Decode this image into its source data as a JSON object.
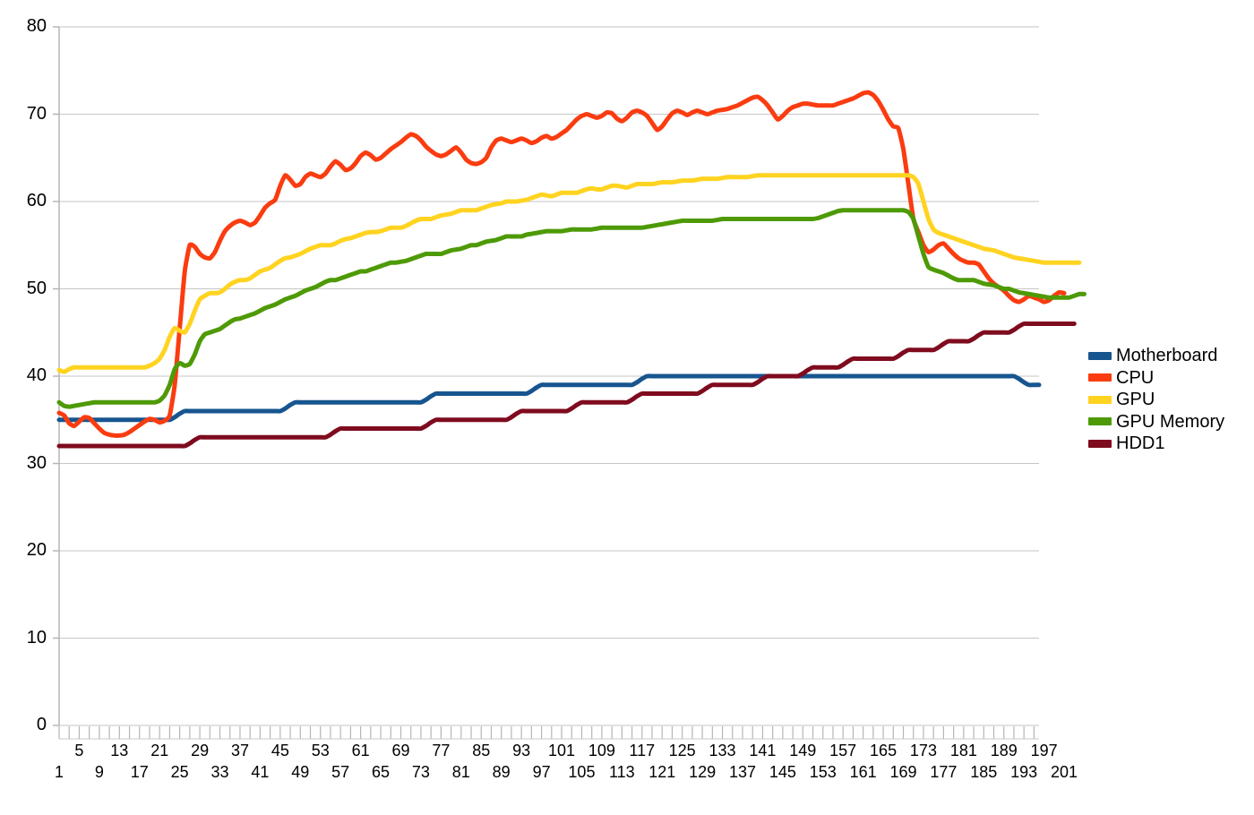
{
  "chart_data": {
    "type": "line",
    "title": "",
    "xlabel": "",
    "ylabel": "",
    "xlim": [
      1,
      201
    ],
    "ylim": [
      0,
      80
    ],
    "grid": true,
    "y_ticks": [
      0,
      10,
      20,
      30,
      40,
      50,
      60,
      70,
      80
    ],
    "x_tick_labels_upper": [
      5,
      13,
      21,
      29,
      37,
      45,
      53,
      61,
      69,
      77,
      85,
      93,
      101,
      109,
      117,
      125,
      133,
      141,
      149,
      157,
      165,
      173,
      181,
      189,
      197
    ],
    "x_tick_labels_lower": [
      1,
      9,
      17,
      25,
      33,
      41,
      49,
      57,
      65,
      73,
      81,
      89,
      97,
      105,
      113,
      121,
      129,
      137,
      145,
      153,
      161,
      169,
      177,
      185,
      193,
      201
    ],
    "x_minor_tick_step": 2,
    "legend_position": "right",
    "series": [
      {
        "name": "Motherboard",
        "color": "#17558F",
        "values": [
          35,
          35,
          35,
          35,
          35,
          35,
          35,
          35,
          35,
          35,
          35,
          35,
          35,
          35,
          35,
          35,
          35,
          35,
          35,
          35,
          35,
          35,
          35,
          35.3,
          35.7,
          36,
          36,
          36,
          36,
          36,
          36,
          36,
          36,
          36,
          36,
          36,
          36,
          36,
          36,
          36,
          36,
          36,
          36,
          36,
          36,
          36.3,
          36.7,
          37,
          37,
          37,
          37,
          37,
          37,
          37,
          37,
          37,
          37,
          37,
          37,
          37,
          37,
          37,
          37,
          37,
          37,
          37,
          37,
          37,
          37,
          37,
          37,
          37,
          37,
          37.3,
          37.7,
          38,
          38,
          38,
          38,
          38,
          38,
          38,
          38,
          38,
          38,
          38,
          38,
          38,
          38,
          38,
          38,
          38,
          38,
          38,
          38.3,
          38.7,
          39,
          39,
          39,
          39,
          39,
          39,
          39,
          39,
          39,
          39,
          39,
          39,
          39,
          39,
          39,
          39,
          39,
          39,
          39,
          39.3,
          39.7,
          40,
          40,
          40,
          40,
          40,
          40,
          40,
          40,
          40,
          40,
          40,
          40,
          40,
          40,
          40,
          40,
          40,
          40,
          40,
          40,
          40,
          40,
          40,
          40,
          40,
          40,
          40,
          40,
          40,
          40,
          40,
          40,
          40,
          40,
          40,
          40,
          40,
          40,
          40,
          40,
          40,
          40,
          40,
          40,
          40,
          40,
          40,
          40,
          40,
          40,
          40,
          40,
          40,
          40,
          40,
          40,
          40,
          40,
          40,
          40,
          40,
          40,
          40,
          40,
          40,
          40,
          40,
          40,
          40,
          40,
          40,
          40,
          40,
          40,
          39.7,
          39.3,
          39,
          39,
          39
        ]
      },
      {
        "name": "CPU",
        "color": "#FA3C10",
        "values": [
          35.8,
          35.5,
          34.6,
          34.3,
          34.8,
          35.3,
          35.2,
          34.6,
          34,
          33.5,
          33.3,
          33.2,
          33.2,
          33.3,
          33.6,
          34,
          34.4,
          34.8,
          35.1,
          35,
          34.7,
          34.9,
          35.5,
          39,
          45.5,
          52,
          55,
          54.8,
          54,
          53.6,
          53.5,
          54.2,
          55.5,
          56.6,
          57.2,
          57.6,
          57.8,
          57.6,
          57.3,
          57.6,
          58.4,
          59.3,
          59.8,
          60.2,
          61.8,
          63,
          62.5,
          61.8,
          62,
          62.8,
          63.2,
          63,
          62.8,
          63.2,
          64,
          64.6,
          64.2,
          63.6,
          63.8,
          64.4,
          65.2,
          65.6,
          65.3,
          64.8,
          65,
          65.5,
          66,
          66.4,
          66.8,
          67.3,
          67.7,
          67.5,
          67,
          66.3,
          65.8,
          65.4,
          65.2,
          65.4,
          65.8,
          66.2,
          65.6,
          64.8,
          64.4,
          64.3,
          64.5,
          65,
          66.2,
          67,
          67.2,
          67,
          66.8,
          67,
          67.2,
          67,
          66.7,
          66.9,
          67.3,
          67.5,
          67.2,
          67.4,
          67.8,
          68.2,
          68.8,
          69.4,
          69.8,
          70,
          69.8,
          69.6,
          69.8,
          70.2,
          70.1,
          69.5,
          69.2,
          69.6,
          70.2,
          70.4,
          70.2,
          69.8,
          69,
          68.2,
          68.6,
          69.4,
          70.1,
          70.4,
          70.2,
          69.9,
          70.2,
          70.4,
          70.2,
          70,
          70.2,
          70.4,
          70.5,
          70.6,
          70.8,
          71,
          71.3,
          71.6,
          71.9,
          72,
          71.6,
          71,
          70.2,
          69.4,
          69.8,
          70.4,
          70.8,
          71,
          71.2,
          71.2,
          71.1,
          71,
          71,
          71,
          71,
          71.2,
          71.4,
          71.6,
          71.8,
          72.1,
          72.4,
          72.5,
          72.2,
          71.5,
          70.5,
          69.4,
          68.6,
          68.4,
          66,
          62,
          58,
          56.5,
          55,
          54.2,
          54.5,
          55,
          55.2,
          54.6,
          54,
          53.5,
          53.2,
          53,
          53,
          52.8,
          52,
          51.2,
          50.6,
          50.2,
          49.8,
          49.2,
          48.7,
          48.5,
          48.8,
          49.2,
          49,
          48.8,
          48.5,
          48.7,
          49.2,
          49.6,
          49.5
        ]
      },
      {
        "name": "GPU",
        "color": "#FFD320",
        "values": [
          40.7,
          40.5,
          40.8,
          41,
          41,
          41,
          41,
          41,
          41,
          41,
          41,
          41,
          41,
          41,
          41,
          41,
          41,
          41,
          41.2,
          41.5,
          42,
          43,
          44.5,
          45.5,
          45.2,
          45,
          46,
          47.5,
          48.8,
          49.2,
          49.5,
          49.5,
          49.6,
          50,
          50.5,
          50.8,
          51,
          51,
          51.2,
          51.6,
          52,
          52.2,
          52.4,
          52.8,
          53.2,
          53.5,
          53.6,
          53.8,
          54,
          54.3,
          54.6,
          54.8,
          55,
          55,
          55,
          55.2,
          55.5,
          55.7,
          55.8,
          56,
          56.2,
          56.4,
          56.5,
          56.5,
          56.6,
          56.8,
          57,
          57,
          57,
          57.2,
          57.5,
          57.8,
          58,
          58,
          58,
          58.2,
          58.4,
          58.5,
          58.6,
          58.8,
          59,
          59,
          59,
          59,
          59.2,
          59.4,
          59.6,
          59.7,
          59.8,
          60,
          60,
          60,
          60.1,
          60.2,
          60.4,
          60.6,
          60.8,
          60.7,
          60.6,
          60.8,
          61,
          61,
          61,
          61,
          61.2,
          61.4,
          61.5,
          61.4,
          61.4,
          61.6,
          61.8,
          61.8,
          61.7,
          61.6,
          61.8,
          62,
          62,
          62,
          62,
          62.1,
          62.2,
          62.2,
          62.2,
          62.3,
          62.4,
          62.4,
          62.4,
          62.5,
          62.6,
          62.6,
          62.6,
          62.6,
          62.7,
          62.8,
          62.8,
          62.8,
          62.8,
          62.8,
          62.9,
          63,
          63,
          63,
          63,
          63,
          63,
          63,
          63,
          63,
          63,
          63,
          63,
          63,
          63,
          63,
          63,
          63,
          63,
          63,
          63,
          63,
          63,
          63,
          63,
          63,
          63,
          63,
          63,
          63,
          63,
          63,
          62.8,
          62,
          60,
          58,
          56.8,
          56.4,
          56.2,
          56,
          55.8,
          55.6,
          55.4,
          55.2,
          55,
          54.8,
          54.6,
          54.5,
          54.4,
          54.2,
          54,
          53.8,
          53.6,
          53.5,
          53.4,
          53.3,
          53.2,
          53.1,
          53,
          53,
          53,
          53,
          53,
          53,
          53,
          53
        ]
      },
      {
        "name": "GPU Memory",
        "color": "#4E9A06",
        "values": [
          37,
          36.6,
          36.5,
          36.6,
          36.7,
          36.8,
          36.9,
          37,
          37,
          37,
          37,
          37,
          37,
          37,
          37,
          37,
          37,
          37,
          37,
          37,
          37.2,
          37.8,
          39,
          40.8,
          41.5,
          41.2,
          41.4,
          42.5,
          44,
          44.8,
          45,
          45.2,
          45.4,
          45.8,
          46.2,
          46.5,
          46.6,
          46.8,
          47,
          47.2,
          47.5,
          47.8,
          48,
          48.2,
          48.5,
          48.8,
          49,
          49.2,
          49.5,
          49.8,
          50,
          50.2,
          50.5,
          50.8,
          51,
          51,
          51.2,
          51.4,
          51.6,
          51.8,
          52,
          52,
          52.2,
          52.4,
          52.6,
          52.8,
          53,
          53,
          53.1,
          53.2,
          53.4,
          53.6,
          53.8,
          54,
          54,
          54,
          54,
          54.2,
          54.4,
          54.5,
          54.6,
          54.8,
          55,
          55,
          55.2,
          55.4,
          55.5,
          55.6,
          55.8,
          56,
          56,
          56,
          56,
          56.2,
          56.3,
          56.4,
          56.5,
          56.6,
          56.6,
          56.6,
          56.6,
          56.7,
          56.8,
          56.8,
          56.8,
          56.8,
          56.8,
          56.9,
          57,
          57,
          57,
          57,
          57,
          57,
          57,
          57,
          57,
          57.1,
          57.2,
          57.3,
          57.4,
          57.5,
          57.6,
          57.7,
          57.8,
          57.8,
          57.8,
          57.8,
          57.8,
          57.8,
          57.8,
          57.9,
          58,
          58,
          58,
          58,
          58,
          58,
          58,
          58,
          58,
          58,
          58,
          58,
          58,
          58,
          58,
          58,
          58,
          58,
          58,
          58.1,
          58.3,
          58.5,
          58.7,
          58.9,
          59,
          59,
          59,
          59,
          59,
          59,
          59,
          59,
          59,
          59,
          59,
          59,
          59,
          58.8,
          58,
          56,
          54,
          52.5,
          52.2,
          52,
          51.8,
          51.5,
          51.2,
          51,
          51,
          51,
          51,
          50.8,
          50.6,
          50.5,
          50.4,
          50.2,
          50,
          50,
          49.8,
          49.6,
          49.5,
          49.4,
          49.3,
          49.2,
          49.1,
          49,
          49,
          49,
          49,
          49,
          49.2,
          49.4,
          49.4
        ]
      },
      {
        "name": "HDD1",
        "color": "#7F0B1E",
        "values": [
          32,
          32,
          32,
          32,
          32,
          32,
          32,
          32,
          32,
          32,
          32,
          32,
          32,
          32,
          32,
          32,
          32,
          32,
          32,
          32,
          32,
          32,
          32,
          32,
          32,
          32,
          32.3,
          32.7,
          33,
          33,
          33,
          33,
          33,
          33,
          33,
          33,
          33,
          33,
          33,
          33,
          33,
          33,
          33,
          33,
          33,
          33,
          33,
          33,
          33,
          33,
          33,
          33,
          33,
          33,
          33.3,
          33.7,
          34,
          34,
          34,
          34,
          34,
          34,
          34,
          34,
          34,
          34,
          34,
          34,
          34,
          34,
          34,
          34,
          34,
          34.3,
          34.7,
          35,
          35,
          35,
          35,
          35,
          35,
          35,
          35,
          35,
          35,
          35,
          35,
          35,
          35,
          35,
          35.3,
          35.7,
          36,
          36,
          36,
          36,
          36,
          36,
          36,
          36,
          36,
          36,
          36.3,
          36.7,
          37,
          37,
          37,
          37,
          37,
          37,
          37,
          37,
          37,
          37,
          37.3,
          37.7,
          38,
          38,
          38,
          38,
          38,
          38,
          38,
          38,
          38,
          38,
          38,
          38,
          38.3,
          38.7,
          39,
          39,
          39,
          39,
          39,
          39,
          39,
          39,
          39,
          39.3,
          39.7,
          40,
          40,
          40,
          40,
          40,
          40,
          40,
          40.3,
          40.7,
          41,
          41,
          41,
          41,
          41,
          41,
          41.3,
          41.7,
          42,
          42,
          42,
          42,
          42,
          42,
          42,
          42,
          42,
          42.3,
          42.7,
          43,
          43,
          43,
          43,
          43,
          43,
          43.3,
          43.7,
          44,
          44,
          44,
          44,
          44,
          44.3,
          44.7,
          45,
          45,
          45,
          45,
          45,
          45,
          45.3,
          45.7,
          46,
          46,
          46,
          46,
          46,
          46,
          46,
          46,
          46,
          46,
          46
        ]
      }
    ]
  }
}
